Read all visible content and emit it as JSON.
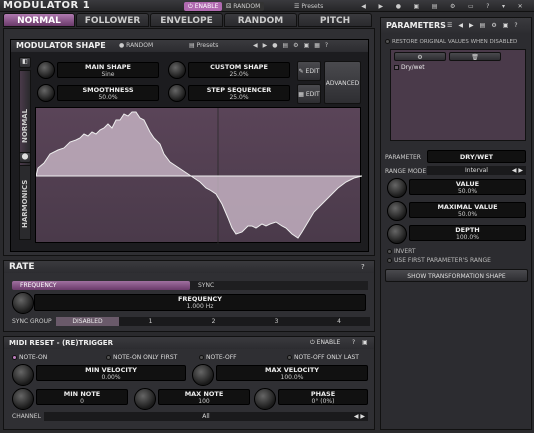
{
  "app": {
    "title": "MODULATOR 1",
    "enable": "ENABLE",
    "random": "RANDOM",
    "presets": "Presets"
  },
  "tabs": [
    "NORMAL",
    "FOLLOWER",
    "ENVELOPE",
    "RANDOM",
    "PITCH"
  ],
  "shape": {
    "header": "MODULATOR SHAPE",
    "random": "RANDOM",
    "presets": "Presets",
    "side_normal": "NORMAL",
    "side_harmonics": "HARMONICS",
    "main_shape_label": "MAIN SHAPE",
    "main_shape_value": "Sine",
    "custom_shape_label": "CUSTOM SHAPE",
    "custom_shape_value": "25.0%",
    "smoothness_label": "SMOOTHNESS",
    "smoothness_value": "50.0%",
    "step_label": "STEP SEQUENCER",
    "step_value": "25.0%",
    "edit1": "EDIT",
    "edit2": "EDIT",
    "advanced": "ADVANCED"
  },
  "rate": {
    "header": "RATE",
    "frequency_tab": "FREQUENCY",
    "sync_tab": "SYNC",
    "frequency_label": "FREQUENCY",
    "frequency_value": "1.000 Hz",
    "sync_group_label": "SYNC GROUP",
    "sync_groups": [
      "DISABLED",
      "1",
      "2",
      "3",
      "4"
    ]
  },
  "midi": {
    "header": "MIDI RESET - (RE)TRIGGER",
    "enable": "ENABLE",
    "note_on": "NOTE-ON",
    "note_on_first": "NOTE-ON ONLY FIRST",
    "note_off": "NOTE-OFF",
    "note_off_last": "NOTE-OFF ONLY LAST",
    "min_vel_label": "MIN VELOCITY",
    "min_vel_value": "0.00%",
    "max_vel_label": "MAX VELOCITY",
    "max_vel_value": "100.0%",
    "min_note_label": "MIN NOTE",
    "min_note_value": "0",
    "max_note_label": "MAX NOTE",
    "max_note_value": "100",
    "phase_label": "PHASE",
    "phase_value": "0° (0%)",
    "channel_label": "CHANNEL",
    "channel_value": "All"
  },
  "params": {
    "header": "PARAMETERS",
    "restore": "RESTORE ORIGINAL VALUES WHEN DISABLED",
    "list_item": "Dry/wet",
    "parameter_label": "PARAMETER",
    "parameter_value": "DRY/WET",
    "range_mode_label": "RANGE MODE",
    "range_mode_value": "Interval",
    "value_label": "VALUE",
    "value_value": "50.0%",
    "max_value_label": "MAXIMAL VALUE",
    "max_value_value": "50.0%",
    "depth_label": "DEPTH",
    "depth_value": "100.0%",
    "invert": "INVERT",
    "use_first": "USE FIRST PARAMETER'S RANGE",
    "show_transform": "SHOW TRANSFORMATION SHAPE"
  }
}
